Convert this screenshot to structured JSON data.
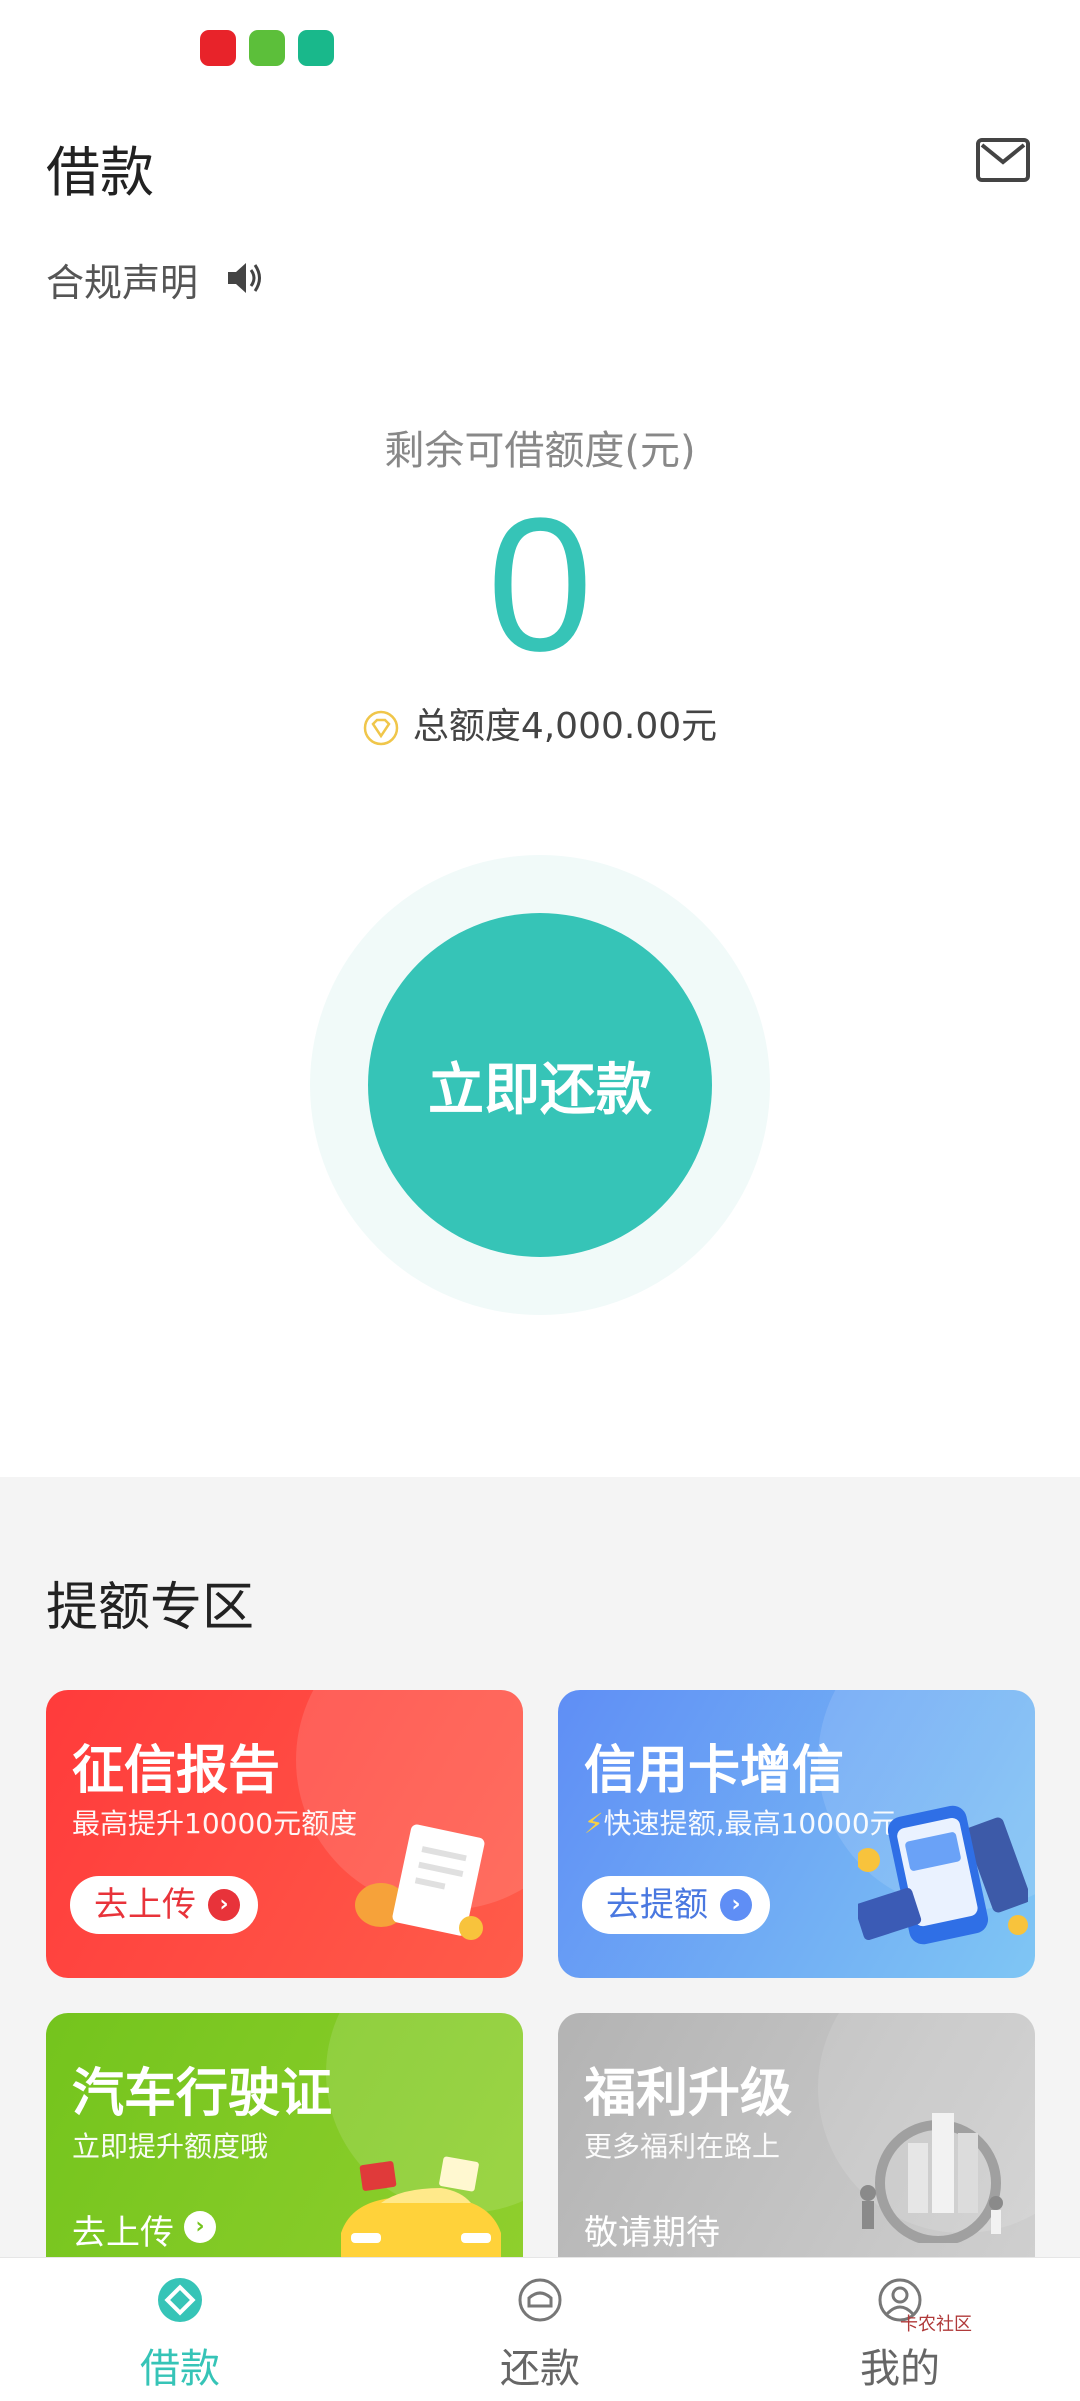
{
  "header": {
    "title": "借款"
  },
  "notice": {
    "label": "合规声明"
  },
  "credit": {
    "label": "剩余可借额度(元)",
    "available": "0",
    "total": "总额度4,000.00元"
  },
  "repay_button": {
    "label": "立即还款"
  },
  "boost_section": {
    "title": "提额专区",
    "cards": [
      {
        "title": "征信报告",
        "subtitle": "最高提升10000元额度",
        "action": "去上传"
      },
      {
        "title": "信用卡增信",
        "subtitle": "快速提额,最高10000元",
        "action": "去提额"
      },
      {
        "title": "汽车行驶证",
        "subtitle": "立即提升额度哦",
        "action": "去上传"
      },
      {
        "title": "福利升级",
        "subtitle": "更多福利在路上",
        "action": "敬请期待"
      }
    ]
  },
  "tabbar": {
    "items": [
      {
        "label": "借款",
        "active": true
      },
      {
        "label": "还款",
        "active": false
      },
      {
        "label": "我的",
        "active": false
      }
    ]
  },
  "watermark": {
    "text": "卡农社区"
  },
  "colors": {
    "accent": "#36c4b7",
    "red": "#ff3b3b",
    "blue": "#5f8ef5",
    "green": "#74c41d",
    "gray": "#b3b3b3"
  }
}
